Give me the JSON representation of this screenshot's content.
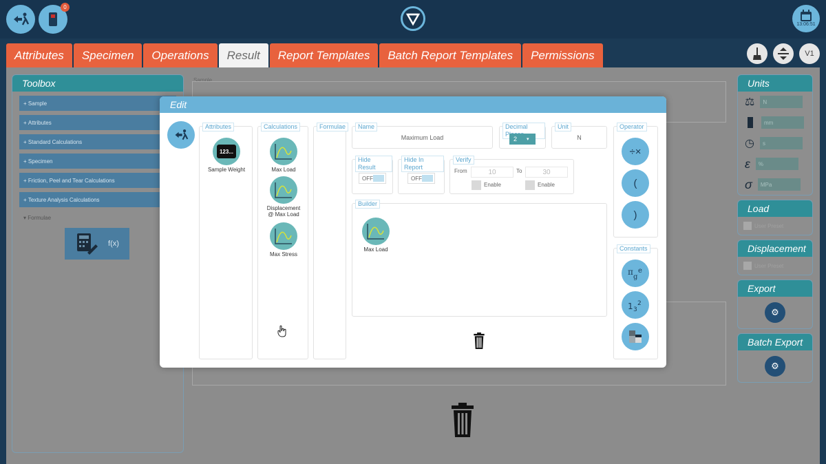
{
  "topbar": {
    "notification_count": "0",
    "clock_time": "13:06:51"
  },
  "tabs": [
    "Attributes",
    "Specimen",
    "Operations",
    "Result",
    "Report Templates",
    "Batch Report Templates",
    "Permissions"
  ],
  "tools": {
    "version_label": "V1"
  },
  "toolbox": {
    "title": "Toolbox",
    "items": [
      "Sample",
      "Attributes",
      "Standard Calculations",
      "Specimen",
      "Friction, Peel and Tear Calculations",
      "Texture Analysis Calculations"
    ],
    "open_item": "Formulae",
    "formula_tile_label": "f(x)"
  },
  "background": {
    "sample_label": "Sample"
  },
  "right_panels": {
    "units_title": "Units",
    "units": [
      {
        "icon": "weight-icon",
        "value": "N"
      },
      {
        "icon": "length-icon",
        "value": "mm"
      },
      {
        "icon": "time-icon",
        "value": "s"
      },
      {
        "icon": "strain-icon",
        "value": "%"
      },
      {
        "icon": "stress-icon",
        "value": "MPa"
      }
    ],
    "load_title": "Load",
    "load_option": "User Preset",
    "displacement_title": "Displacement",
    "displacement_option": "User Preset",
    "export_title": "Export",
    "batch_export_title": "Batch Export"
  },
  "modal": {
    "title": "Edit",
    "attributes_legend": "Attributes",
    "attributes": [
      {
        "label": "Sample Weight",
        "icon_text": "123..."
      }
    ],
    "calculations_legend": "Calculations",
    "calculations": [
      "Max Load",
      "Displacement @ Max Load",
      "Max Stress"
    ],
    "formulae_legend": "Formulae",
    "name_legend": "Name",
    "name_value": "Maximum Load",
    "decimal_legend": "Decimal Places",
    "decimal_value": "2",
    "unit_legend": "Unit",
    "unit_value": "N",
    "hide_result_legend": "Hide Result",
    "hide_result_value": "OFF",
    "hide_report_legend": "Hide In Report",
    "hide_report_value": "OFF",
    "verify_legend": "Verify",
    "from_label": "From",
    "from_value": "10",
    "to_label": "To",
    "to_value": "30",
    "enable_label": "Enable",
    "builder_legend": "Builder",
    "builder_items": [
      "Max Load"
    ],
    "operator_legend": "Operator",
    "operators": [
      "÷×",
      "(",
      ")"
    ],
    "constants_legend": "Constants"
  },
  "colors": {
    "accent_orange": "#e8623e",
    "accent_blue": "#6ab2d8",
    "teal": "#2f8f98",
    "navy": "#17344f"
  }
}
